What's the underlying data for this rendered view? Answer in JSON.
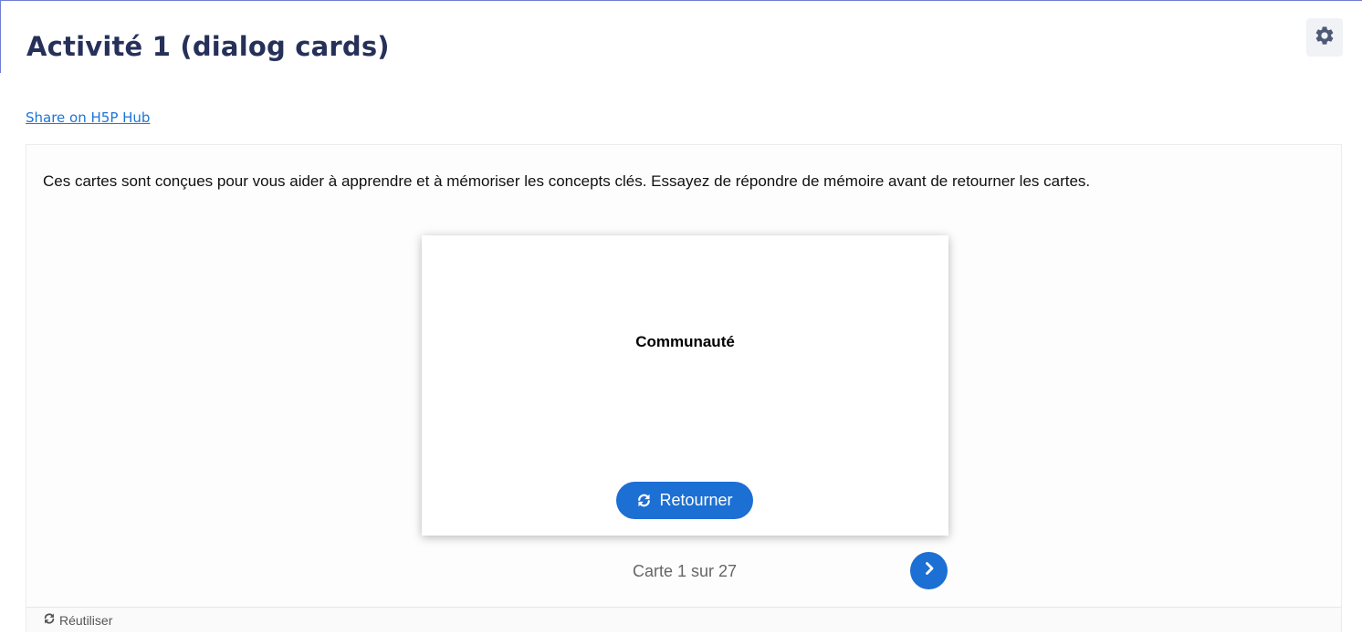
{
  "header": {
    "title": "Activité 1 (dialog cards)",
    "settings_icon": "gear-icon"
  },
  "share_link": "Share on H5P Hub",
  "content": {
    "intro": "Ces cartes sont conçues pour vous aider à apprendre et à mémoriser les concepts clés. Essayez de répondre de mémoire avant de retourner les cartes.",
    "card": {
      "text": "Communauté",
      "flip_label": "Retourner",
      "flip_icon": "refresh-icon"
    },
    "progress": {
      "text": "Carte 1 sur 27",
      "current": 1,
      "total": 27
    },
    "next_icon": "chevron-right-icon"
  },
  "footer": {
    "reuse_label": "Réutiliser",
    "reuse_icon": "refresh-icon"
  },
  "colors": {
    "title": "#263159",
    "link": "#1d74d6",
    "accent_button": "#1c6fd3",
    "frame_line": "#6f7fd6"
  }
}
